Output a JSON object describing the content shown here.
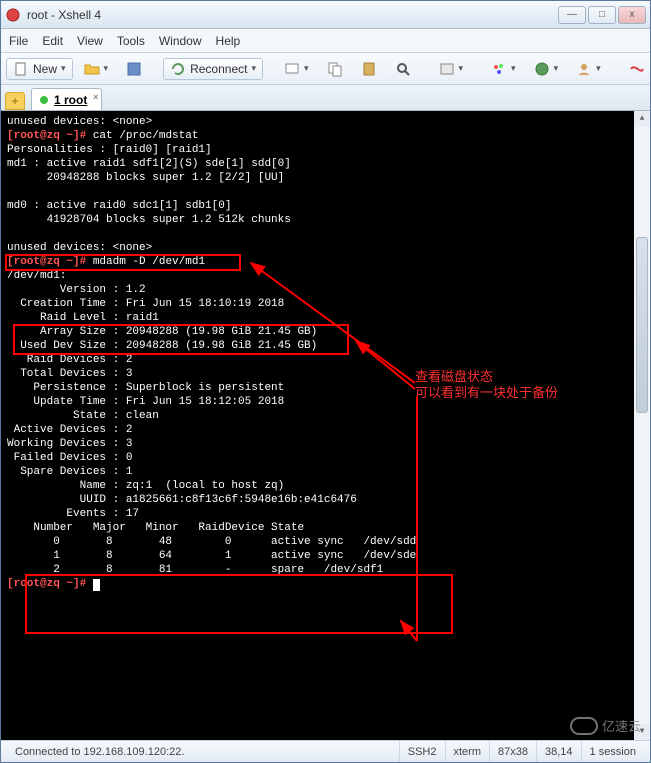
{
  "window": {
    "title": "root - Xshell 4"
  },
  "winbtns": {
    "min": "—",
    "max": "□",
    "close": "x"
  },
  "menu": {
    "file": "File",
    "edit": "Edit",
    "view": "View",
    "tools": "Tools",
    "window": "Window",
    "help": "Help"
  },
  "toolbar": {
    "new": "New",
    "reconnect": "Reconnect",
    "icons": {
      "new": "new-file-icon",
      "open": "folder-open-icon",
      "save": "save-icon",
      "reconnect": "reconnect-icon",
      "screen": "screen-icon",
      "copy": "copy-icon",
      "paste": "paste-icon",
      "search": "search-icon",
      "props": "props-icon",
      "colors": "color-palette-icon",
      "globe": "globe-icon",
      "profile": "profile-icon",
      "sftp": "red-arrow-icon",
      "layout1": "layout-icon",
      "layout2": "layout-grid-icon",
      "cascade": "cascade-icon"
    }
  },
  "tab": {
    "add": "+",
    "status": "connected",
    "name": "1 root"
  },
  "terminal": {
    "l01": "unused devices: <none>",
    "l02_p": "[root@zq ~]# ",
    "l02_c": "cat /proc/mdstat",
    "l03": "Personalities : [raid0] [raid1] ",
    "l04": "md1 : active raid1 sdf1[2](S) sde[1] sdd[0]",
    "l05": "      20948288 blocks super 1.2 [2/2] [UU]",
    "l06": "      ",
    "l07": "md0 : active raid0 sdc1[1] sdb1[0]",
    "l08": "      41928704 blocks super 1.2 512k chunks",
    "l09": "      ",
    "l10": "unused devices: <none>",
    "l11_p": "[root@zq ~]# ",
    "l11_c": "mdadm -D /dev/md1",
    "l12": "/dev/md1:",
    "l13": "        Version : 1.2",
    "l14": "  Creation Time : Fri Jun 15 18:10:19 2018",
    "l15": "     Raid Level : raid1",
    "l16": "     Array Size : 20948288 (19.98 GiB 21.45 GB)",
    "l17": "  Used Dev Size : 20948288 (19.98 GiB 21.45 GB)",
    "l18": "   Raid Devices : 2",
    "l19": "  Total Devices : 3",
    "l20": "    Persistence : Superblock is persistent",
    "l21": "",
    "l22": "    Update Time : Fri Jun 15 18:12:05 2018",
    "l23": "          State : clean ",
    "l24": " Active Devices : 2",
    "l25": "Working Devices : 3",
    "l26": " Failed Devices : 0",
    "l27": "  Spare Devices : 1",
    "l28": "",
    "l29": "           Name : zq:1  (local to host zq)",
    "l30": "           UUID : a1825661:c8f13c6f:5948e16b:e41c6476",
    "l31": "         Events : 17",
    "l32": "",
    "l33": "    Number   Major   Minor   RaidDevice State",
    "l34": "       0       8       48        0      active sync   /dev/sdd",
    "l35": "       1       8       64        1      active sync   /dev/sde",
    "l36": "",
    "l37": "       2       8       81        -      spare   /dev/sdf1",
    "l38_p": "[root@zq ~]# "
  },
  "annotations": {
    "a1": "查看磁盘状态",
    "a2": "可以看到有一块处于备份"
  },
  "statusbar": {
    "conn": "Connected to 192.168.109.120:22.",
    "proto": "SSH2",
    "term": "xterm",
    "size": "87x38",
    "pos": "38,14",
    "sess": "1 session"
  },
  "watermark": {
    "text": "亿速云"
  }
}
